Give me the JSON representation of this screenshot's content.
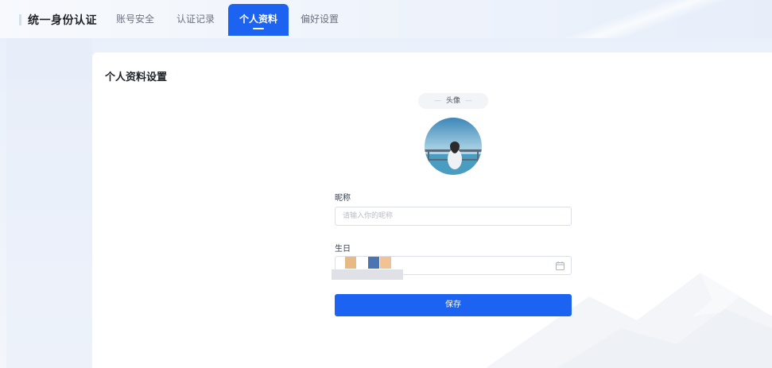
{
  "brand": {
    "title": "统一身份认证"
  },
  "nav": {
    "items": [
      {
        "label": "账号安全"
      },
      {
        "label": "认证记录"
      },
      {
        "label": "个人资料"
      },
      {
        "label": "偏好设置"
      }
    ],
    "active_index": 2
  },
  "card": {
    "title": "个人资料设置",
    "avatar_section": {
      "label": "头像",
      "dash": "—"
    },
    "nickname": {
      "label": "昵称",
      "value": "",
      "placeholder": "请输入你的昵称"
    },
    "birthday": {
      "label": "生日",
      "icon": "calendar-icon"
    },
    "save_label": "保存"
  },
  "colors": {
    "accent": "#1c63f2",
    "background": "#eef3fb",
    "card": "#ffffff"
  }
}
